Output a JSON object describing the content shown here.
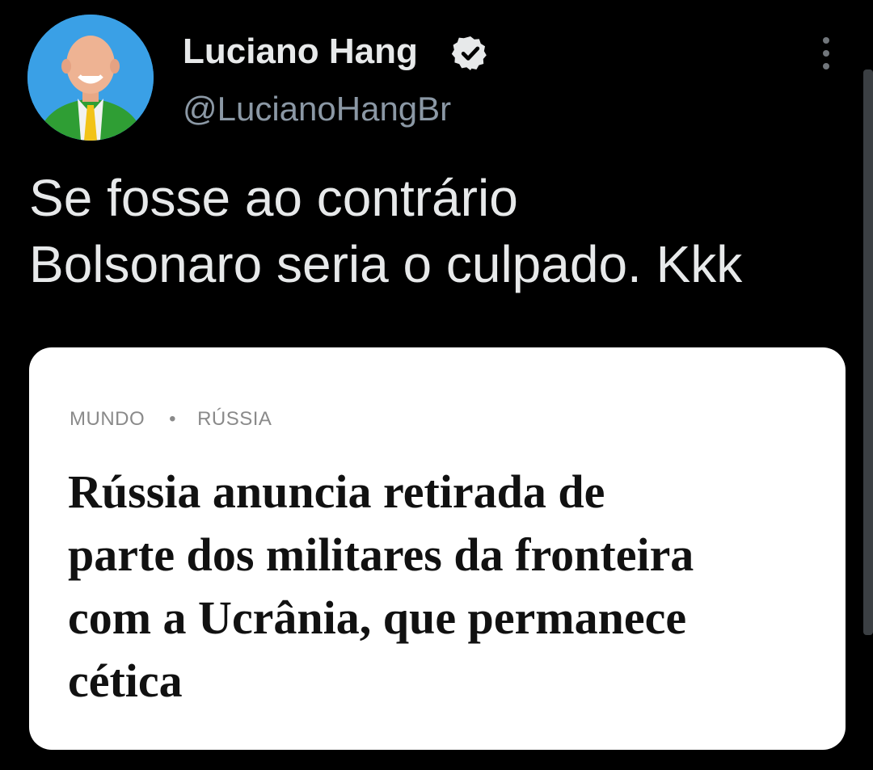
{
  "author": {
    "display_name": "Luciano Hang",
    "handle": "@LucianoHangBr",
    "verified": true,
    "avatar_icon": "profile-photo",
    "verified_icon": "verified-badge-icon"
  },
  "tweet": {
    "text_lines": [
      "Se fosse ao contrário",
      "Bolsonaro seria o culpado. Kkk"
    ]
  },
  "card": {
    "section": "MUNDO",
    "separator": "•",
    "topic": "RÚSSIA",
    "headline_lines": [
      "Rússia anuncia retirada de",
      "parte dos militares da fronteira",
      "com a Ucrânia, que permanece",
      "cética"
    ]
  },
  "colors": {
    "background": "#000000",
    "primary_text": "#e7e9ea",
    "secondary_text": "#8b98a5",
    "card_background": "#ffffff",
    "headline_text": "#111111"
  },
  "icons": {
    "more": "more-options-icon"
  }
}
